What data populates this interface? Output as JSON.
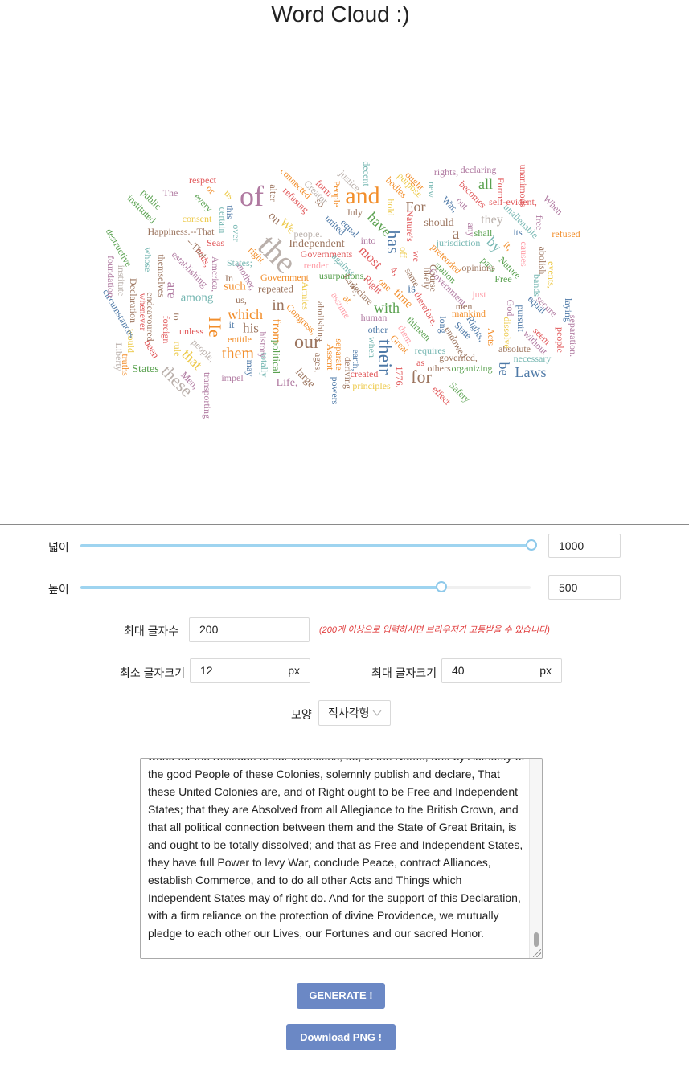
{
  "page_title": "Word Cloud :)",
  "cloud": {
    "word_colors": [
      "#4e79a7",
      "#f28e2b",
      "#e15759",
      "#76b7b2",
      "#59a14f",
      "#edc948",
      "#b07aa1",
      "#ff9da7",
      "#9c755f",
      "#bab0ab"
    ],
    "words": [
      {
        "text": "the",
        "color": "#bab0ab"
      },
      {
        "text": "of",
        "color": "#b07aa1"
      },
      {
        "text": "and",
        "color": "#f28e2b"
      },
      {
        "text": "our",
        "color": "#9c755f"
      },
      {
        "text": "their",
        "color": "#4e79a7"
      },
      {
        "text": "for",
        "color": "#9c755f"
      },
      {
        "text": "has",
        "color": "#4e79a7"
      },
      {
        "text": "He",
        "color": "#f28e2b"
      },
      {
        "text": "in",
        "color": "#9c755f"
      },
      {
        "text": "these",
        "color": "#bab0ab"
      },
      {
        "text": "them",
        "color": "#f28e2b"
      },
      {
        "text": "which",
        "color": "#f28e2b"
      },
      {
        "text": "have",
        "color": "#59a14f"
      },
      {
        "text": "Laws",
        "color": "#4e79a7"
      },
      {
        "text": "by",
        "color": "#76b7b2"
      },
      {
        "text": "For",
        "color": "#9c755f"
      },
      {
        "text": "that",
        "color": "#edc948"
      },
      {
        "text": "with",
        "color": "#59a14f"
      },
      {
        "text": "his",
        "color": "#9c755f"
      },
      {
        "text": "be",
        "color": "#4e79a7"
      },
      {
        "text": "all",
        "color": "#59a14f"
      },
      {
        "text": "a",
        "color": "#9c755f"
      },
      {
        "text": "they",
        "color": "#bab0ab"
      },
      {
        "text": "from",
        "color": "#f28e2b"
      },
      {
        "text": "most",
        "color": "#e15759"
      },
      {
        "text": "are",
        "color": "#b07aa1"
      },
      {
        "text": "among",
        "color": "#76b7b2"
      },
      {
        "text": "such",
        "color": "#f28e2b"
      },
      {
        "text": "time",
        "color": "#f28e2b"
      },
      {
        "text": "is",
        "color": "#4e79a7"
      },
      {
        "text": "on",
        "color": "#9c755f"
      },
      {
        "text": "We",
        "color": "#edc948"
      },
      {
        "text": "should",
        "color": "#9c755f"
      },
      {
        "text": "Independent",
        "color": "#9c755f"
      },
      {
        "text": "Governments",
        "color": "#e15759"
      },
      {
        "text": "Government",
        "color": "#f28e2b"
      },
      {
        "text": "usurpations,",
        "color": "#59a14f"
      },
      {
        "text": "repeated",
        "color": "#9c755f"
      },
      {
        "text": "political",
        "color": "#59a14f"
      },
      {
        "text": "large",
        "color": "#9c755f"
      },
      {
        "text": "Life,",
        "color": "#b07aa1"
      },
      {
        "text": "States",
        "color": "#59a14f"
      },
      {
        "text": "Men,",
        "color": "#b07aa1"
      },
      {
        "text": "been",
        "color": "#e15759"
      },
      {
        "text": "people,",
        "color": "#bab0ab"
      },
      {
        "text": "unless",
        "color": "#e15759"
      },
      {
        "text": "to",
        "color": "#9c755f"
      },
      {
        "text": "foreign",
        "color": "#e15759"
      },
      {
        "text": "rule",
        "color": "#edc948"
      },
      {
        "text": "entitle",
        "color": "#f28e2b"
      },
      {
        "text": "it",
        "color": "#4e79a7"
      },
      {
        "text": "history",
        "color": "#b07aa1"
      },
      {
        "text": "totally",
        "color": "#76b7b2"
      },
      {
        "text": "may",
        "color": "#4e79a7"
      },
      {
        "text": "impel",
        "color": "#b07aa1"
      },
      {
        "text": "transporting",
        "color": "#b07aa1"
      },
      {
        "text": "Liberty",
        "color": "#bab0ab"
      },
      {
        "text": "truths",
        "color": "#f28e2b"
      },
      {
        "text": "would",
        "color": "#edc948"
      },
      {
        "text": "circumstances",
        "color": "#4e79a7"
      },
      {
        "text": "institute",
        "color": "#bab0ab"
      },
      {
        "text": "foundation",
        "color": "#b07aa1"
      },
      {
        "text": "destructive",
        "color": "#59a14f"
      },
      {
        "text": "Declaration",
        "color": "#9c755f"
      },
      {
        "text": "whenever",
        "color": "#e15759"
      },
      {
        "text": "endeavoured",
        "color": "#9c755f"
      },
      {
        "text": "themselves",
        "color": "#9c755f"
      },
      {
        "text": "whose",
        "color": "#76b7b2"
      },
      {
        "text": "establishing",
        "color": "#b07aa1"
      },
      {
        "text": "ends,",
        "color": "#e15759"
      },
      {
        "text": "--That",
        "color": "#9c755f"
      },
      {
        "text": "America,",
        "color": "#b07aa1"
      },
      {
        "text": "Seas",
        "color": "#e15759"
      },
      {
        "text": "Happiness.--That",
        "color": "#9c755f"
      },
      {
        "text": "consent",
        "color": "#edc948"
      },
      {
        "text": "instituted",
        "color": "#59a14f"
      },
      {
        "text": "public",
        "color": "#59a14f"
      },
      {
        "text": "The",
        "color": "#b07aa1"
      },
      {
        "text": "every",
        "color": "#59a14f"
      },
      {
        "text": "respect",
        "color": "#e15759"
      },
      {
        "text": "or",
        "color": "#f28e2b"
      },
      {
        "text": "us",
        "color": "#edc948"
      },
      {
        "text": "certain",
        "color": "#76b7b2"
      },
      {
        "text": "this",
        "color": "#4e79a7"
      },
      {
        "text": "over",
        "color": "#76b7b2"
      },
      {
        "text": "alter",
        "color": "#9c755f"
      },
      {
        "text": "refusing",
        "color": "#e15759"
      },
      {
        "text": "connected",
        "color": "#f28e2b"
      },
      {
        "text": "Creator",
        "color": "#bab0ab"
      },
      {
        "text": "so",
        "color": "#9c755f"
      },
      {
        "text": "form",
        "color": "#e15759"
      },
      {
        "text": "People",
        "color": "#f28e2b"
      },
      {
        "text": "justice",
        "color": "#bab0ab"
      },
      {
        "text": "decent",
        "color": "#76b7b2"
      },
      {
        "text": "July",
        "color": "#9c755f"
      },
      {
        "text": "united",
        "color": "#4e79a7"
      },
      {
        "text": "equal",
        "color": "#4e79a7"
      },
      {
        "text": "bodies",
        "color": "#f28e2b"
      },
      {
        "text": "hold",
        "color": "#edc948"
      },
      {
        "text": "purpose",
        "color": "#edc948"
      },
      {
        "text": "ought",
        "color": "#f28e2b"
      },
      {
        "text": "new",
        "color": "#76b7b2"
      },
      {
        "text": "Nature's",
        "color": "#e15759"
      },
      {
        "text": "rights,",
        "color": "#b07aa1"
      },
      {
        "text": "declaring",
        "color": "#b07aa1"
      },
      {
        "text": "becomes",
        "color": "#e15759"
      },
      {
        "text": "out",
        "color": "#b07aa1"
      },
      {
        "text": "War,",
        "color": "#4e79a7"
      },
      {
        "text": "Form",
        "color": "#e15759"
      },
      {
        "text": "unanimous",
        "color": "#e15759"
      },
      {
        "text": "self-evident,",
        "color": "#e15759"
      },
      {
        "text": "When",
        "color": "#b07aa1"
      },
      {
        "text": "free",
        "color": "#b07aa1"
      },
      {
        "text": "unalienable",
        "color": "#76b7b2"
      },
      {
        "text": "refused",
        "color": "#f28e2b"
      },
      {
        "text": "its",
        "color": "#4e79a7"
      },
      {
        "text": "any",
        "color": "#b07aa1"
      },
      {
        "text": "shall",
        "color": "#59a14f"
      },
      {
        "text": "it,",
        "color": "#f28e2b"
      },
      {
        "text": "Nature",
        "color": "#59a14f"
      },
      {
        "text": "causes",
        "color": "#ff9da7"
      },
      {
        "text": "abolish",
        "color": "#9c755f"
      },
      {
        "text": "events,",
        "color": "#edc948"
      },
      {
        "text": "jurisdiction",
        "color": "#76b7b2"
      },
      {
        "text": "pretended",
        "color": "#f28e2b"
      },
      {
        "text": "station",
        "color": "#59a14f"
      },
      {
        "text": "pass",
        "color": "#59a14f"
      },
      {
        "text": "opinions",
        "color": "#9c755f"
      },
      {
        "text": "Free",
        "color": "#59a14f"
      },
      {
        "text": "bands",
        "color": "#76b7b2"
      },
      {
        "text": "secure",
        "color": "#b07aa1"
      },
      {
        "text": "equal",
        "color": "#4e79a7"
      },
      {
        "text": "laying",
        "color": "#4e79a7"
      },
      {
        "text": "separation.",
        "color": "#b07aa1"
      },
      {
        "text": "people",
        "color": "#e15759"
      },
      {
        "text": "seem",
        "color": "#e15759"
      },
      {
        "text": "without",
        "color": "#b07aa1"
      },
      {
        "text": "pursuit",
        "color": "#4e79a7"
      },
      {
        "text": "God",
        "color": "#b07aa1"
      },
      {
        "text": "dissolve",
        "color": "#edc948"
      },
      {
        "text": "absolute",
        "color": "#9c755f"
      },
      {
        "text": "Acts",
        "color": "#f28e2b"
      },
      {
        "text": "Rights,",
        "color": "#4e79a7"
      },
      {
        "text": "just",
        "color": "#ff9da7"
      },
      {
        "text": "Government,",
        "color": "#b07aa1"
      },
      {
        "text": "men",
        "color": "#9c755f"
      },
      {
        "text": "mankind",
        "color": "#f28e2b"
      },
      {
        "text": "State",
        "color": "#4e79a7"
      },
      {
        "text": "endowed",
        "color": "#9c755f"
      },
      {
        "text": "necessary",
        "color": "#76b7b2"
      },
      {
        "text": "governed,",
        "color": "#9c755f"
      },
      {
        "text": "organizing",
        "color": "#59a14f"
      },
      {
        "text": "Safety",
        "color": "#59a14f"
      },
      {
        "text": "effect",
        "color": "#e15759"
      },
      {
        "text": "as",
        "color": "#e15759"
      },
      {
        "text": "others",
        "color": "#9c755f"
      },
      {
        "text": "requires",
        "color": "#76b7b2"
      },
      {
        "text": "long",
        "color": "#4e79a7"
      },
      {
        "text": "therefore,",
        "color": "#e15759"
      },
      {
        "text": "thirteen",
        "color": "#59a14f"
      },
      {
        "text": "them.",
        "color": "#ff9da7"
      },
      {
        "text": "Great",
        "color": "#f28e2b"
      },
      {
        "text": "Course",
        "color": "#9c755f"
      },
      {
        "text": "likely",
        "color": "#9c755f"
      },
      {
        "text": "same",
        "color": "#9c755f"
      },
      {
        "text": "we",
        "color": "#e15759"
      },
      {
        "text": "off",
        "color": "#edc948"
      },
      {
        "text": "4,",
        "color": "#e15759"
      },
      {
        "text": "one",
        "color": "#f28e2b"
      },
      {
        "text": "Right",
        "color": "#e15759"
      },
      {
        "text": "declare",
        "color": "#9c755f"
      },
      {
        "text": "Laws,",
        "color": "#9c755f"
      },
      {
        "text": "at",
        "color": "#f28e2b"
      },
      {
        "text": "against",
        "color": "#76b7b2"
      },
      {
        "text": "assume",
        "color": "#ff9da7"
      },
      {
        "text": "render",
        "color": "#ff9da7"
      },
      {
        "text": "people.",
        "color": "#bab0ab"
      },
      {
        "text": "into",
        "color": "#b07aa1"
      },
      {
        "text": "1776.",
        "color": "#e15759"
      },
      {
        "text": "other",
        "color": "#4e79a7"
      },
      {
        "text": "human",
        "color": "#b07aa1"
      },
      {
        "text": "when",
        "color": "#76b7b2"
      },
      {
        "text": "earth,",
        "color": "#4e79a7"
      },
      {
        "text": "created",
        "color": "#e15759"
      },
      {
        "text": "deriving",
        "color": "#9c755f"
      },
      {
        "text": "principles",
        "color": "#edc948"
      },
      {
        "text": "powers",
        "color": "#4e79a7"
      },
      {
        "text": "separate",
        "color": "#f28e2b"
      },
      {
        "text": "Assent",
        "color": "#f28e2b"
      },
      {
        "text": "abolishing",
        "color": "#9c755f"
      },
      {
        "text": "ages,",
        "color": "#9c755f"
      },
      {
        "text": "Armies",
        "color": "#edc948"
      },
      {
        "text": "Congress,",
        "color": "#f28e2b"
      },
      {
        "text": "us,",
        "color": "#9c755f"
      },
      {
        "text": "In",
        "color": "#9c755f"
      },
      {
        "text": "another,",
        "color": "#b07aa1"
      },
      {
        "text": "States;",
        "color": "#76b7b2"
      },
      {
        "text": "right",
        "color": "#f28e2b"
      }
    ]
  },
  "controls": {
    "width_label": "넓이",
    "width_value": "1000",
    "width_fraction": 1.0,
    "height_label": "높이",
    "height_value": "500",
    "height_fraction": 0.8,
    "max_words_label": "최대 글자수",
    "max_words_value": "200",
    "max_words_warning": "(200개 이상으로 입력하시면 브라우저가 고통받을 수 있습니다)",
    "min_font_label": "최소 글자크기",
    "min_font_value": "12",
    "max_font_label": "최대 글자크기",
    "max_font_value": "40",
    "unit_px": "px",
    "shape_label": "모양",
    "shape_value": "직사각형",
    "chevron_icon": "chevron-down-icon"
  },
  "text_input": {
    "content": "world for the rectitude of our intentions, do, in the Name, and by Authority of the good People of these Colonies, solemnly publish and declare, That these United Colonies are, and of Right ought to be Free and Independent States; that they are Absolved from all Allegiance to the British Crown, and that all political connection between them and the State of Great Britain, is and ought to be totally dissolved; and that as Free and Independent States, they have full Power to levy War, conclude Peace, contract Alliances, establish Commerce, and to do all other Acts and Things which Independent States may of right do. And for the support of this Declaration, with a firm reliance on the protection of divine Providence, we mutually pledge to each other our Lives, our Fortunes and our sacred Honor."
  },
  "buttons": {
    "generate_label": "GENERATE !",
    "download_label": "Download PNG !"
  }
}
